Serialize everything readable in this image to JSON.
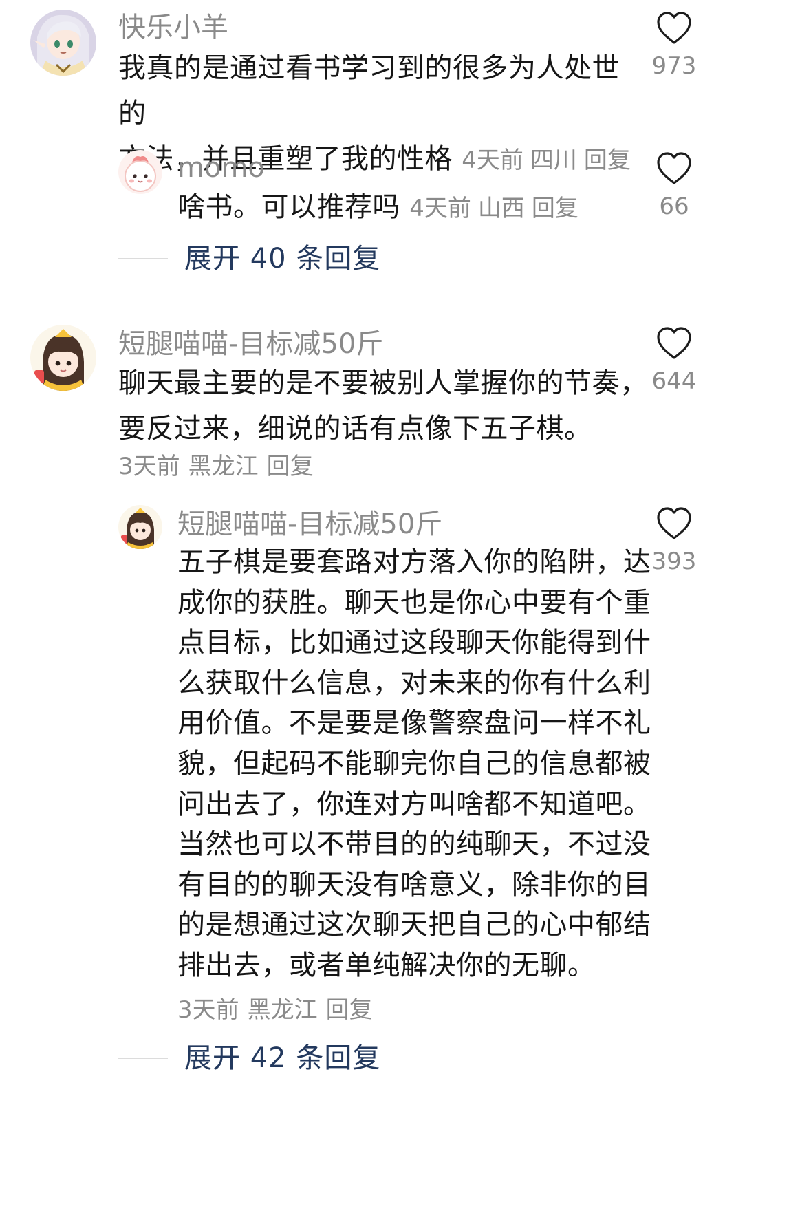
{
  "comments": [
    {
      "username": "快乐小羊",
      "avatar_icon": "anime-girl-avatar-icon",
      "lines": [
        "我真的是通过看书学习到的很多为人处世的",
        "方法，并且重塑了我的性格"
      ],
      "time": "4天前",
      "location": "四川",
      "reply_label": "回复",
      "like_count": "973",
      "replies": [
        {
          "username": "momo",
          "avatar_icon": "pink-character-avatar-icon",
          "text": "啥书。可以推荐吗",
          "time": "4天前",
          "location": "山西",
          "reply_label": "回复",
          "like_count": "66"
        }
      ],
      "expand_label": "展开 40 条回复"
    },
    {
      "username": "短腿喵喵-目标减50斤",
      "avatar_icon": "anime-girl-yellow-avatar-icon",
      "lines": [
        "聊天最主要的是不要被别人掌握你的节奏，",
        "要反过来，细说的话有点像下五子棋。"
      ],
      "time": "3天前",
      "location": "黑龙江",
      "reply_label": "回复",
      "like_count": "644",
      "replies": [
        {
          "username": "短腿喵喵-目标减50斤",
          "avatar_icon": "anime-girl-yellow-avatar-icon",
          "lines": [
            "五子棋是要套路对方落入你的陷阱，达",
            "成你的获胜。聊天也是你心中要有个重",
            "点目标，比如通过这段聊天你能得到什",
            "么获取什么信息，对未来的你有什么利",
            "用价值。不是要是像警察盘问一样不礼",
            "貌，但起码不能聊完你自己的信息都被",
            "问出去了，你连对方叫啥都不知道吧。",
            "当然也可以不带目的的纯聊天，不过没",
            "有目的的聊天没有啥意义，除非你的目",
            "的是想通过这次聊天把自己的心中郁结",
            "排出去，或者单纯解决你的无聊。"
          ],
          "time": "3天前",
          "location": "黑龙江",
          "reply_label": "回复",
          "like_count": "393"
        }
      ],
      "expand_label": "展开 42 条回复"
    }
  ],
  "icons": {
    "like": "heart-outline-icon"
  },
  "colors": {
    "text": "#161616",
    "meta": "#8a8a8a",
    "link": "#23395e"
  }
}
